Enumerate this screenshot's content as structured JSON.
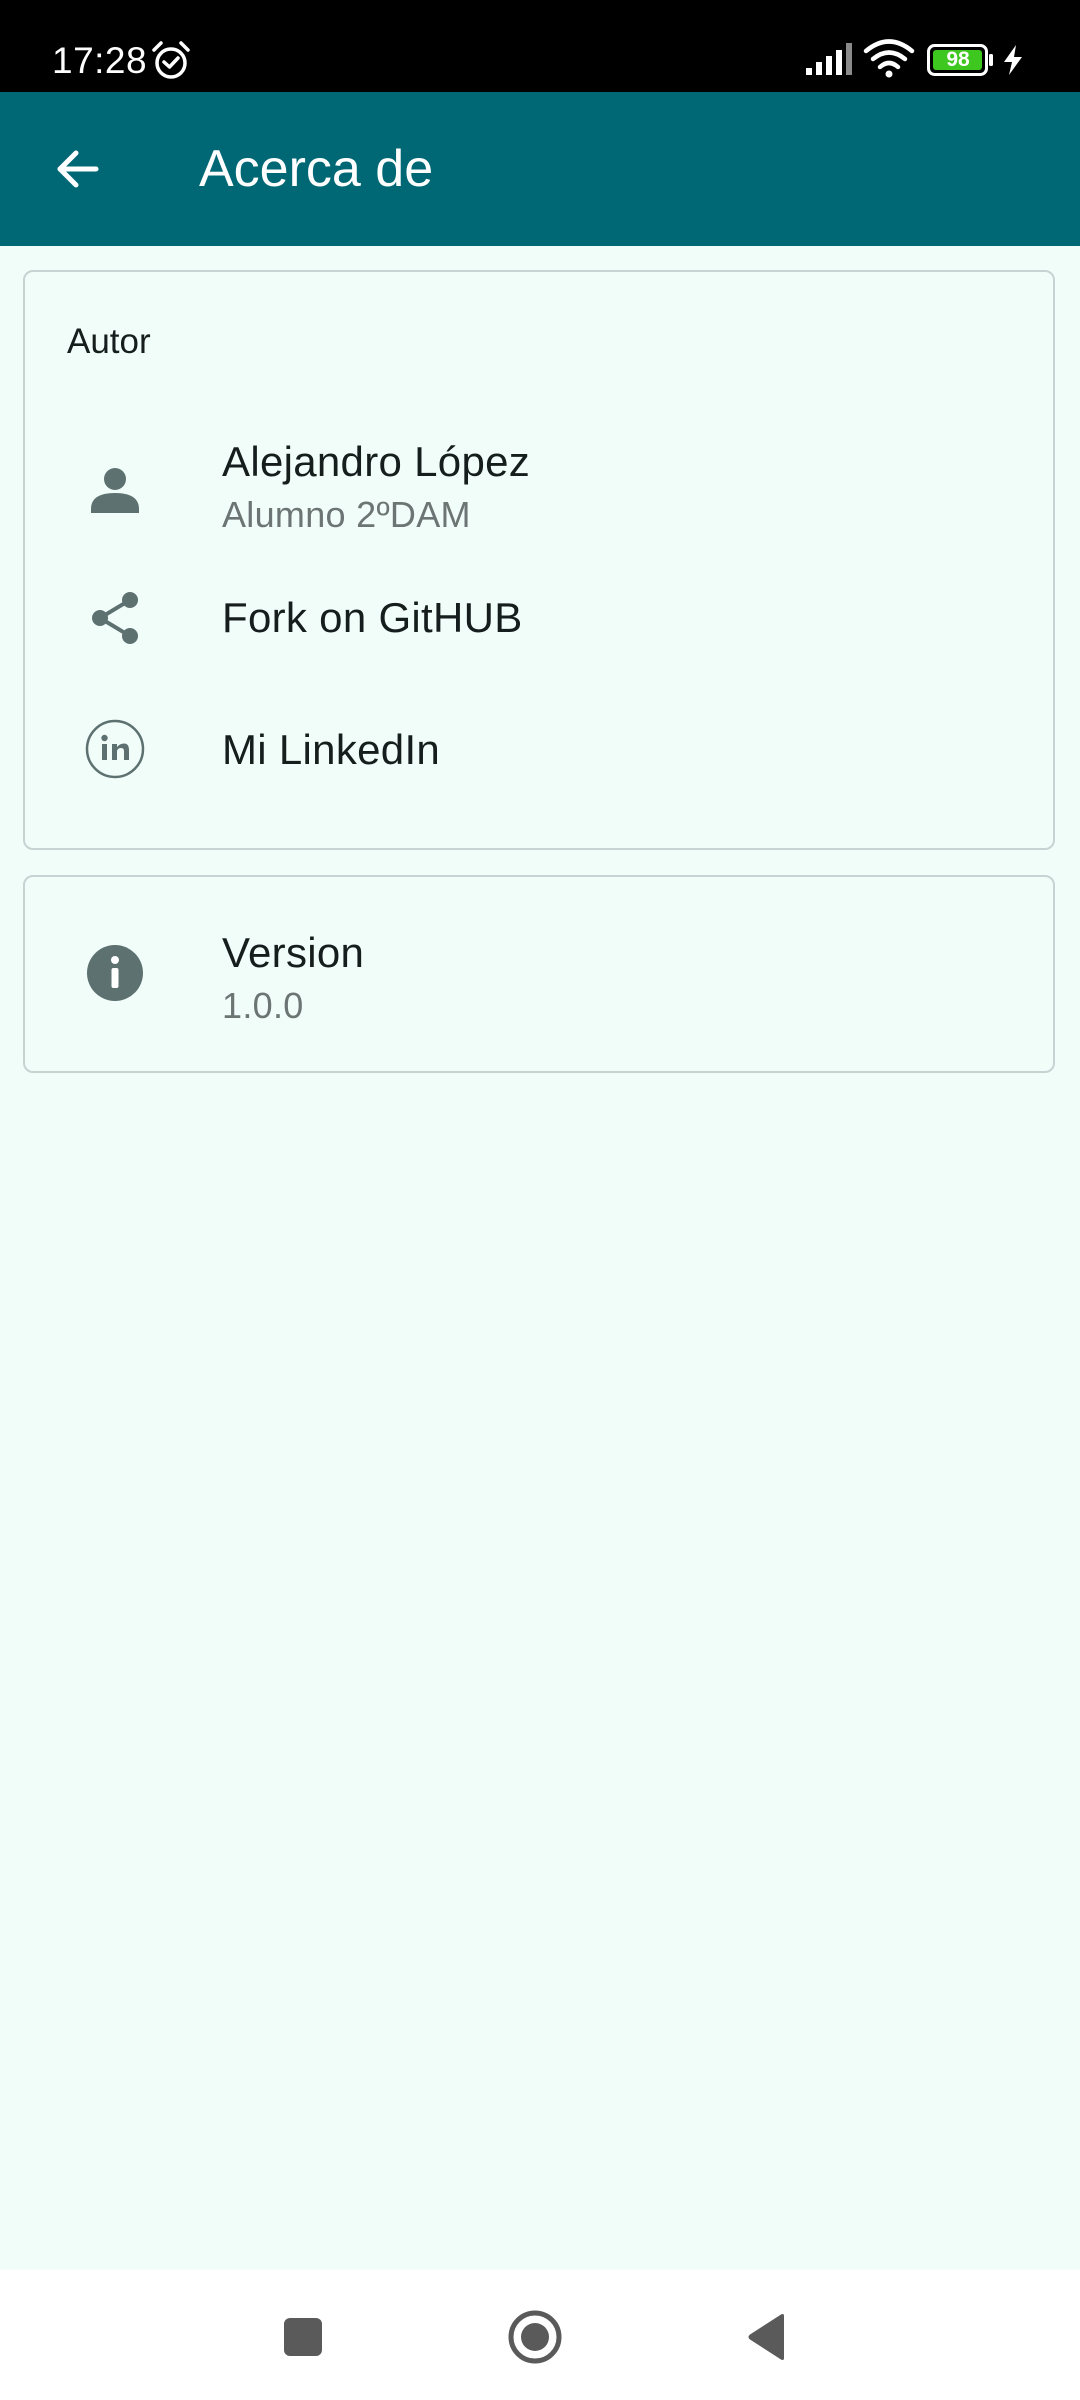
{
  "status_bar": {
    "time": "17:28",
    "battery_level": "98",
    "icons": [
      "alarm-icon",
      "signal-icon",
      "wifi-icon",
      "battery-icon",
      "charging-icon"
    ]
  },
  "app_bar": {
    "title": "Acerca de",
    "back_icon": "arrow-back-icon",
    "background_color": "#006874"
  },
  "author_card": {
    "header": "Autor",
    "items": [
      {
        "title": "Alejandro López",
        "subtitle": "Alumno 2ºDAM",
        "icon": "person-icon"
      },
      {
        "title": "Fork on GitHUB",
        "icon": "share-icon"
      },
      {
        "title": "Mi LinkedIn",
        "icon": "linkedin-icon"
      }
    ]
  },
  "version_card": {
    "title": "Version",
    "value": "1.0.0",
    "icon": "info-icon"
  },
  "nav_bar": {
    "buttons": [
      "recents-button",
      "home-button",
      "back-button"
    ]
  },
  "colors": {
    "primary": "#006874",
    "background": "#f1fdf9",
    "icon": "#5d7170",
    "battery": "#3ec71e"
  }
}
